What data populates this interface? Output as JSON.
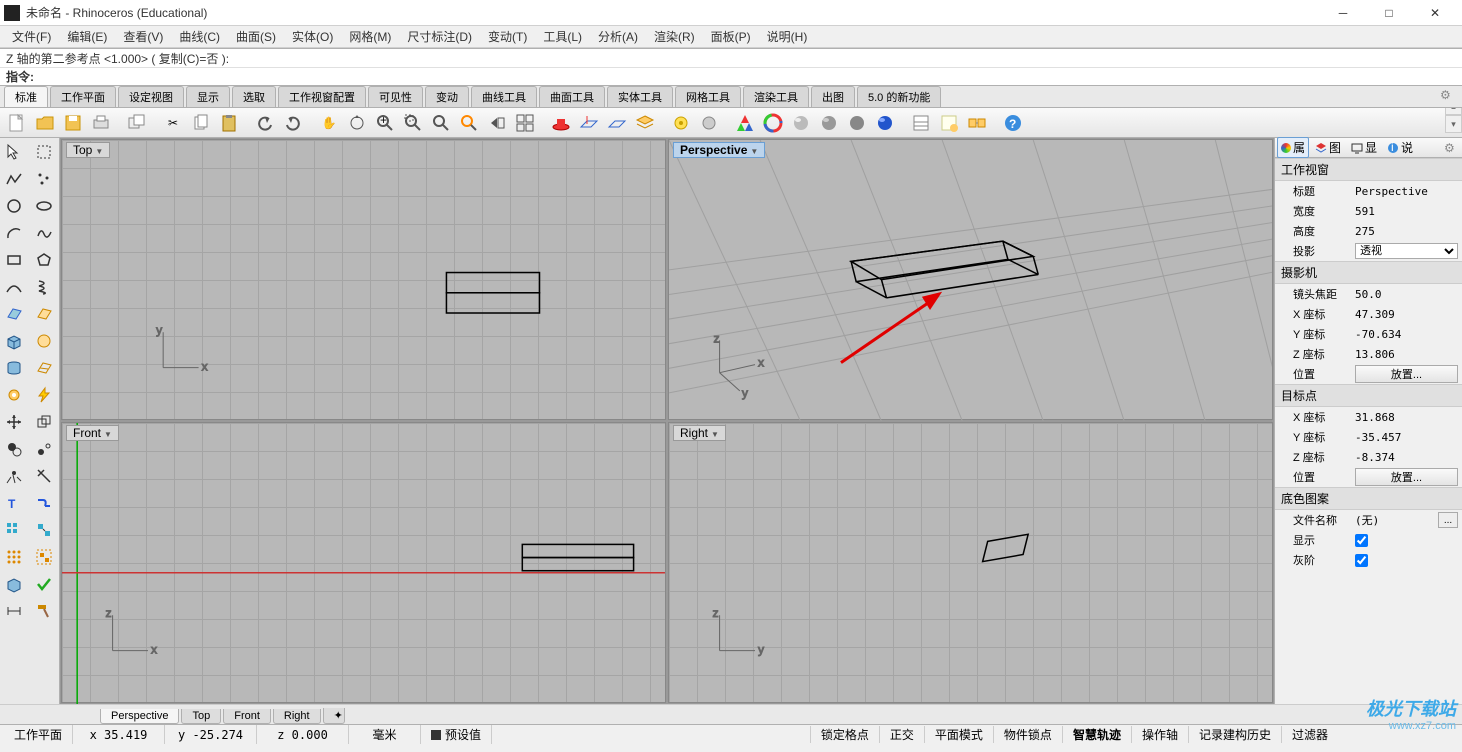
{
  "window": {
    "title": "未命名 - Rhinoceros (Educational)"
  },
  "menu": [
    "文件(F)",
    "编辑(E)",
    "查看(V)",
    "曲线(C)",
    "曲面(S)",
    "实体(O)",
    "网格(M)",
    "尺寸标注(D)",
    "变动(T)",
    "工具(L)",
    "分析(A)",
    "渲染(R)",
    "面板(P)",
    "说明(H)"
  ],
  "command": {
    "history": "Z 轴的第二参考点 <1.000> ( 复制(C)=否 ):",
    "prompt": "指令:"
  },
  "tool_tabs": [
    "标准",
    "工作平面",
    "设定视图",
    "显示",
    "选取",
    "工作视窗配置",
    "可见性",
    "变动",
    "曲线工具",
    "曲面工具",
    "实体工具",
    "网格工具",
    "渲染工具",
    "出图",
    "5.0 的新功能"
  ],
  "viewports": {
    "top": "Top",
    "perspective": "Perspective",
    "front": "Front",
    "right": "Right"
  },
  "right_panel": {
    "tabs": [
      {
        "icon": "circle-rainbow",
        "label": "属"
      },
      {
        "icon": "layers",
        "label": "图"
      },
      {
        "icon": "monitor",
        "label": "显"
      },
      {
        "icon": "info",
        "label": "说"
      }
    ],
    "active_tab": 0,
    "sections": {
      "viewport": {
        "header": "工作视窗",
        "title_label": "标题",
        "title_value": "Perspective",
        "width_label": "宽度",
        "width_value": "591",
        "height_label": "高度",
        "height_value": "275",
        "projection_label": "投影",
        "projection_value": "透视"
      },
      "camera": {
        "header": "摄影机",
        "focal_label": "镜头焦距",
        "focal_value": "50.0",
        "x_label": "X 座标",
        "x_value": "47.309",
        "y_label": "Y 座标",
        "y_value": "-70.634",
        "z_label": "Z 座标",
        "z_value": "13.806",
        "pos_label": "位置",
        "pos_btn": "放置..."
      },
      "target": {
        "header": "目标点",
        "x_label": "X 座标",
        "x_value": "31.868",
        "y_label": "Y 座标",
        "y_value": "-35.457",
        "z_label": "Z 座标",
        "z_value": "-8.374",
        "pos_label": "位置",
        "pos_btn": "放置..."
      },
      "background": {
        "header": "底色图案",
        "file_label": "文件名称",
        "file_value": "(无)",
        "show_label": "显示",
        "gray_label": "灰阶"
      }
    }
  },
  "bottom_tabs": [
    "Perspective",
    "Top",
    "Front",
    "Right"
  ],
  "status": {
    "plane": "工作平面",
    "x": "x 35.419",
    "y": "y -25.274",
    "z": "z 0.000",
    "units": "毫米",
    "preset": "预设值",
    "panes": [
      "锁定格点",
      "正交",
      "平面模式",
      "物件锁点",
      "智慧轨迹",
      "操作轴",
      "记录建构历史",
      "过滤器"
    ],
    "active_pane": "智慧轨迹"
  },
  "watermark": {
    "line1": "极光下载站",
    "line2": "www.xz7.com"
  }
}
